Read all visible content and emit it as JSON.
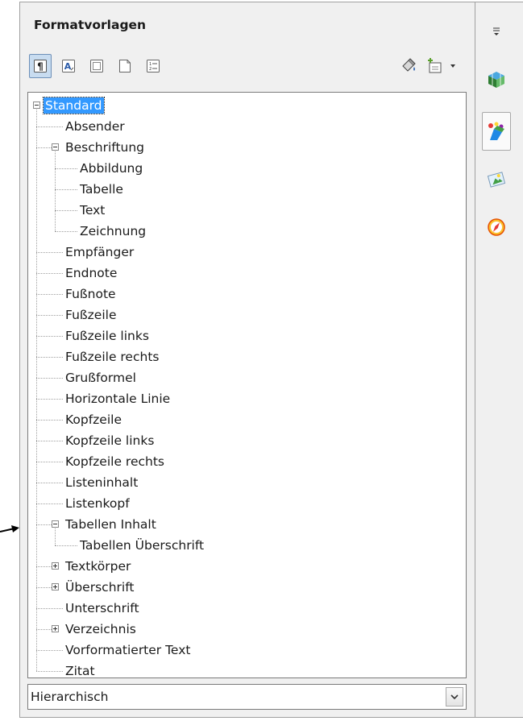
{
  "panel": {
    "title": "Formatvorlagen"
  },
  "toolbar": {
    "buttons": [
      {
        "name": "paragraph-styles-icon",
        "active": true
      },
      {
        "name": "character-styles-icon",
        "active": false
      },
      {
        "name": "frame-styles-icon",
        "active": false
      },
      {
        "name": "page-styles-icon",
        "active": false
      },
      {
        "name": "list-styles-icon",
        "active": false
      },
      {
        "name": "fill-format-mode-icon",
        "active": false
      },
      {
        "name": "new-style-icon",
        "active": false
      }
    ]
  },
  "tree": {
    "items": [
      {
        "label": "Standard",
        "level": 0,
        "toggle": "minus",
        "selected": true
      },
      {
        "label": "Absender",
        "level": 1
      },
      {
        "label": "Beschriftung",
        "level": 1,
        "toggle": "minus"
      },
      {
        "label": "Abbildung",
        "level": 2
      },
      {
        "label": "Tabelle",
        "level": 2
      },
      {
        "label": "Text",
        "level": 2
      },
      {
        "label": "Zeichnung",
        "level": 2
      },
      {
        "label": "Empfänger",
        "level": 1
      },
      {
        "label": "Endnote",
        "level": 1
      },
      {
        "label": "Fußnote",
        "level": 1
      },
      {
        "label": "Fußzeile",
        "level": 1
      },
      {
        "label": "Fußzeile links",
        "level": 1
      },
      {
        "label": "Fußzeile rechts",
        "level": 1
      },
      {
        "label": "Grußformel",
        "level": 1
      },
      {
        "label": "Horizontale Linie",
        "level": 1
      },
      {
        "label": "Kopfzeile",
        "level": 1
      },
      {
        "label": "Kopfzeile links",
        "level": 1
      },
      {
        "label": "Kopfzeile rechts",
        "level": 1
      },
      {
        "label": "Listeninhalt",
        "level": 1
      },
      {
        "label": "Listenkopf",
        "level": 1
      },
      {
        "label": "Tabellen Inhalt",
        "level": 1,
        "toggle": "minus"
      },
      {
        "label": "Tabellen Überschrift",
        "level": 2
      },
      {
        "label": "Textkörper",
        "level": 1,
        "toggle": "plus"
      },
      {
        "label": "Überschrift",
        "level": 1,
        "toggle": "plus"
      },
      {
        "label": "Unterschrift",
        "level": 1
      },
      {
        "label": "Verzeichnis",
        "level": 1,
        "toggle": "plus"
      },
      {
        "label": "Vorformatierter Text",
        "level": 1
      },
      {
        "label": "Zitat",
        "level": 1
      }
    ]
  },
  "filter": {
    "value": "Hierarchisch"
  },
  "sidebar": {
    "buttons": [
      {
        "name": "sidebar-menu-icon"
      },
      {
        "name": "properties-cube-icon"
      },
      {
        "name": "styles-formatting-icon",
        "active": true
      },
      {
        "name": "gallery-icon"
      },
      {
        "name": "navigator-compass-icon"
      }
    ]
  },
  "colors": {
    "selection": "#3399ff",
    "panel_bg": "#f0f0f0"
  }
}
